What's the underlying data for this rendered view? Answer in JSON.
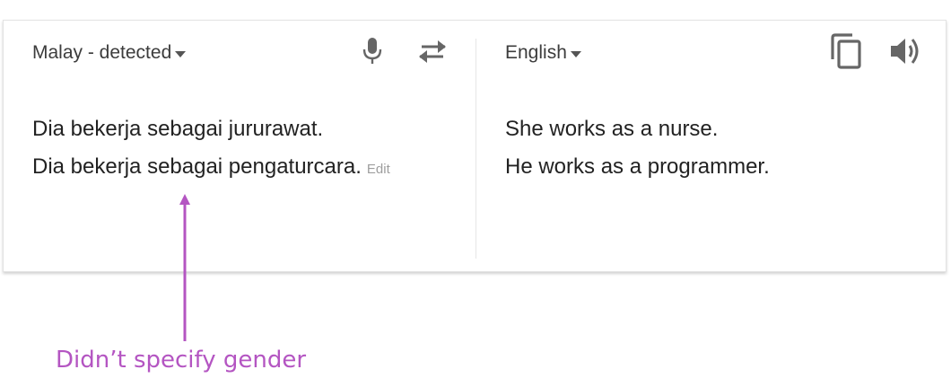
{
  "source": {
    "language_label": "Malay - detected",
    "lines": [
      "Dia bekerja sebagai jururawat.",
      "Dia bekerja sebagai pengaturcara."
    ],
    "edit_label": "Edit"
  },
  "target": {
    "language_label": "English",
    "lines": [
      "She works as a nurse.",
      "He works as a programmer."
    ]
  },
  "icons": {
    "mic": "microphone-icon",
    "swap": "swap-languages-icon",
    "copy": "copy-icon",
    "speaker": "speaker-icon"
  },
  "annotation": {
    "text": "Didn’t specify gender",
    "color": "#b455c2"
  }
}
